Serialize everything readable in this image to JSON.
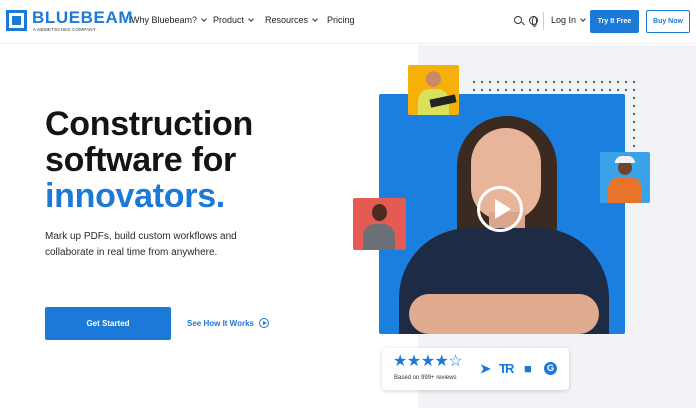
{
  "brand": {
    "name": "BLUEBEAM",
    "tagline": "A NEMETSCHEK COMPANY",
    "accent": "#1b79d8"
  },
  "nav": {
    "items": [
      {
        "label": "Why Bluebeam?",
        "has_dropdown": true
      },
      {
        "label": "Product",
        "has_dropdown": true
      },
      {
        "label": "Resources",
        "has_dropdown": true
      },
      {
        "label": "Pricing",
        "has_dropdown": false
      }
    ],
    "login_label": "Log In",
    "try_label": "Try It Free",
    "buy_label": "Buy Now",
    "icons": [
      "search-icon",
      "globe-icon"
    ]
  },
  "hero": {
    "title_line1": "Construction",
    "title_line2": "software for",
    "title_accent": "innovators.",
    "description": "Mark up PDFs, build custom workflows and collaborate in real time from anywhere.",
    "primary_cta": "Get Started",
    "secondary_cta": "See How It Works"
  },
  "rating": {
    "stars": "★★★★☆",
    "value": 4.5,
    "text": "Based on 999+ reviews",
    "review_sites": [
      "capterra-icon",
      "trustradius-icon",
      "software-advice-icon",
      "g2-icon"
    ]
  }
}
